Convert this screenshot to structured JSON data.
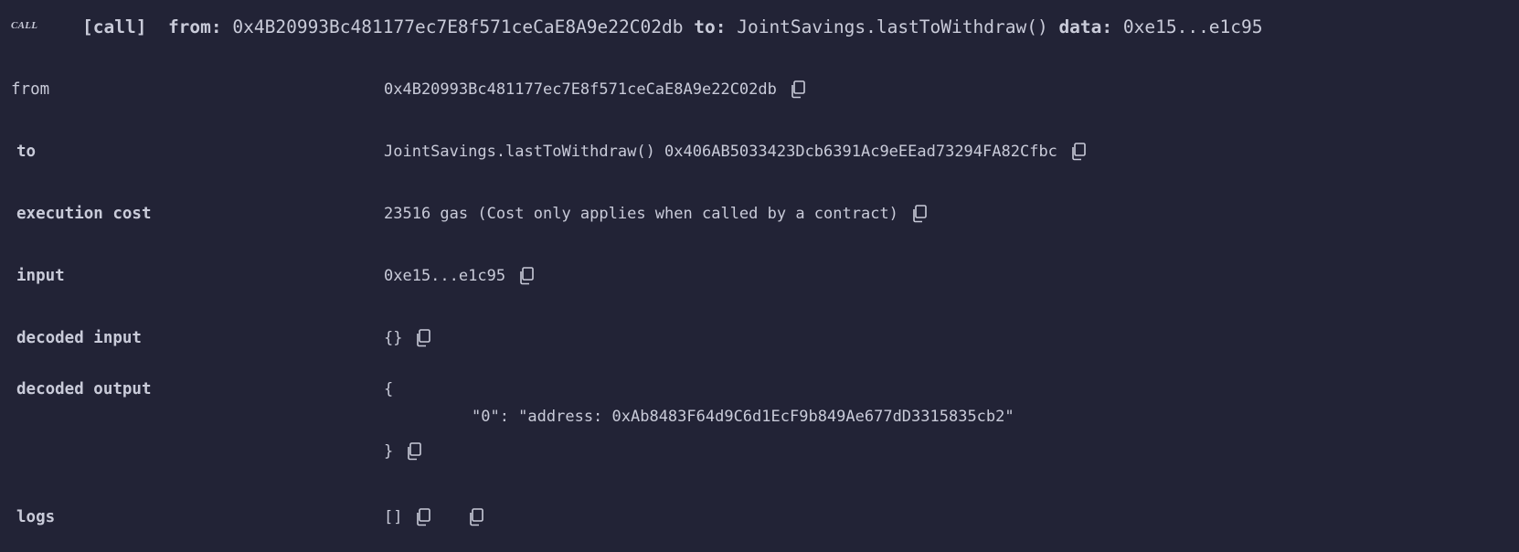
{
  "header": {
    "call_tag": "CALL",
    "kind": "[call]",
    "from_label": "from:",
    "from_value": "0x4B20993Bc481177ec7E8f571ceCaE8A9e22C02db",
    "to_label": "to:",
    "to_value": "JointSavings.lastToWithdraw()",
    "data_label": "data:",
    "data_value": "0xe15...e1c95"
  },
  "rows": {
    "from": {
      "label": "from",
      "value": "0x4B20993Bc481177ec7E8f571ceCaE8A9e22C02db"
    },
    "to": {
      "label": "to",
      "value": "JointSavings.lastToWithdraw() 0x406AB5033423Dcb6391Ac9eEEad73294FA82Cfbc"
    },
    "execution_cost": {
      "label": "execution cost",
      "value": "23516 gas (Cost only applies when called by a contract)"
    },
    "input": {
      "label": "input",
      "value": "0xe15...e1c95"
    },
    "decoded_input": {
      "label": "decoded input",
      "value": "{}"
    },
    "decoded_output": {
      "label": "decoded output",
      "open": "{",
      "entry": "\"0\": \"address: 0xAb8483F64d9C6d1EcF9b849Ae677dD3315835cb2\"",
      "close": "}"
    },
    "logs": {
      "label": "logs",
      "value": "[]"
    }
  },
  "icons": {
    "copy": "copy-icon"
  },
  "colors": {
    "background": "#222336",
    "text": "#c9cbd9"
  }
}
